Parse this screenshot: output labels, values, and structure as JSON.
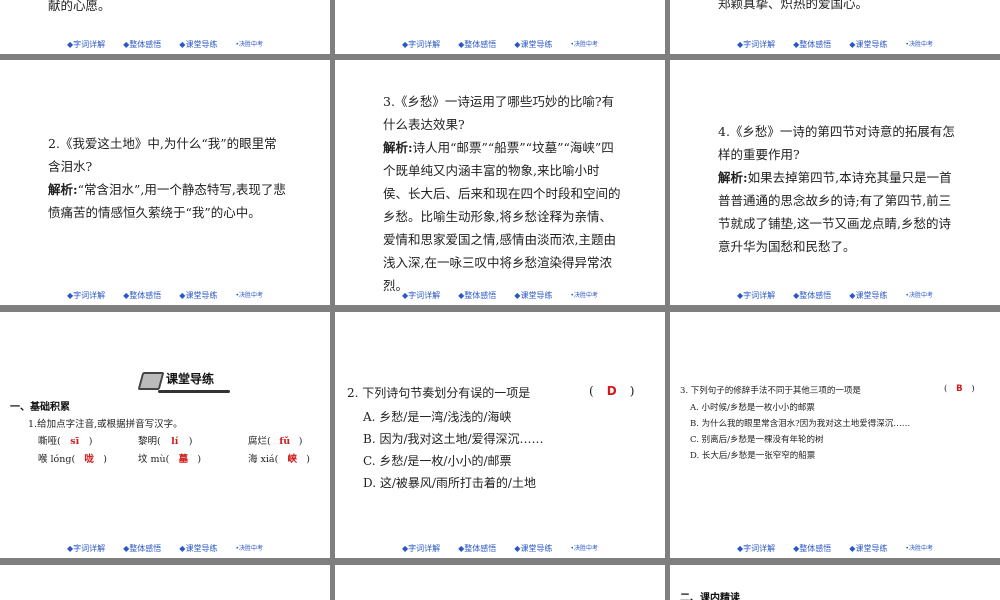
{
  "nav": {
    "item1": "◆字词详解",
    "item2": "◆整体感悟",
    "item3": "◆课堂导练",
    "item4": "•决胜中考"
  },
  "top_left_tail": "献的心愿。",
  "top_right_tail": "郑颖真挚、炽热的爱国心。",
  "s4": {
    "question": "2.《我爱这土地》中,为什么“我”的眼里常含泪水?",
    "label": "解析:",
    "answer": "“常含泪水”,用一个静态特写,表现了悲愤痛苦的情感恒久萦绕于“我”的心中。"
  },
  "s5": {
    "question": "3.《乡愁》一诗运用了哪些巧妙的比喻?有什么表达效果?",
    "label": "解析:",
    "answer": "诗人用“邮票”“船票”“坟墓”“海峡”四个既单纯又内涵丰富的物象,来比喻小时侯、长大后、后来和现在四个时段和空间的乡愁。比喻生动形象,将乡愁诠释为亲情、爱情和思家爱国之情,感情由淡而浓,主题由浅入深,在一咏三叹中将乡愁渲染得异常浓烈。"
  },
  "s6": {
    "question": "4.《乡愁》一诗的第四节对诗意的拓展有怎样的重要作用?",
    "label": "解析:",
    "answer": "如果去掉第四节,本诗充其量只是一首普普通通的思念故乡的诗;有了第四节,前三节就成了铺垫,这一节又画龙点睛,乡愁的诗意升华为国愁和民愁了。"
  },
  "s7": {
    "banner": "课堂导练",
    "section": "一、基础积累",
    "instruction": "1.给加点字注音,或根据拼音写汉字。",
    "items": [
      {
        "word": "嘶哑(",
        "answer": "sī",
        "close": ")"
      },
      {
        "word": "黎明(",
        "answer": "lí",
        "close": ")"
      },
      {
        "word": "腐烂(",
        "answer": "fǔ",
        "close": ")"
      },
      {
        "word": "喉 lóng(",
        "answer": "咙",
        "close": ")"
      },
      {
        "word": "坟 mù(",
        "answer": "墓",
        "close": ")"
      },
      {
        "word": "海 xiá(",
        "answer": "峡",
        "close": ")"
      }
    ]
  },
  "s8": {
    "question": "2. 下列诗句节奏划分有误的一项是",
    "answer_open": "(",
    "answer": "D",
    "answer_close": ")",
    "options": [
      "A. 乡愁/是一湾/浅浅的/海峡",
      "B. 因为/我对这土地/爱得深沉……",
      "C. 乡愁/是一枚/小小的/邮票",
      "D. 这/被暴风/雨所打击着的/土地"
    ]
  },
  "s9": {
    "question": "3. 下列句子的修辞手法不同于其他三项的一项是",
    "answer_open": "(",
    "answer": "B",
    "answer_close": ")",
    "options": [
      "A. 小时候/乡愁是一枚小小的邮票",
      "B. 为什么我的眼里常含泪水?因为我对这土地爱得深沉……",
      "C. 别离后/乡愁是一棵没有年轮的树",
      "D. 长大后/乡愁是一张窄窄的船票"
    ]
  },
  "s12": {
    "section": "二、课内精读"
  }
}
